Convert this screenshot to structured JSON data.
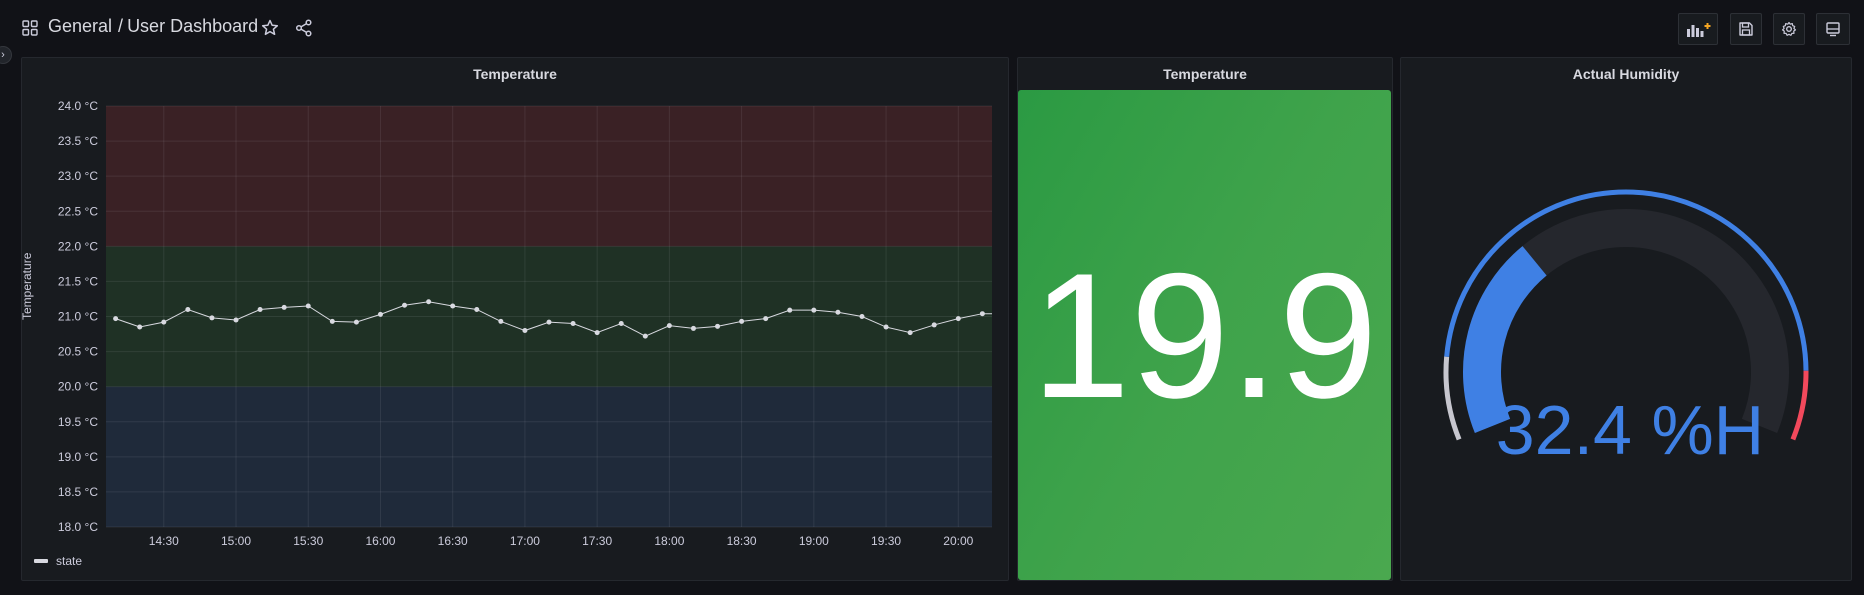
{
  "header": {
    "folder": "General",
    "separator": "/",
    "dashboard": "User Dashboard"
  },
  "panels": {
    "temp_graph": {
      "title": "Temperature"
    },
    "temp_stat": {
      "title": "Temperature",
      "value": "19.9",
      "color": "#3fa34b"
    },
    "humidity_gauge": {
      "title": "Actual Humidity",
      "value": "32.4 %H",
      "fraction": 0.324,
      "color": "#3f80e4"
    }
  },
  "chart_data": {
    "type": "line",
    "title": "Temperature",
    "ylabel": "Temperature",
    "ylim": [
      18.0,
      24.0
    ],
    "y_ticks": [
      "24.0 °C",
      "23.5 °C",
      "23.0 °C",
      "22.5 °C",
      "22.0 °C",
      "21.5 °C",
      "21.0 °C",
      "20.5 °C",
      "20.0 °C",
      "19.5 °C",
      "19.0 °C",
      "18.5 °C",
      "18.0 °C"
    ],
    "x_ticks": [
      "14:30",
      "15:00",
      "15:30",
      "16:00",
      "16:30",
      "17:00",
      "17:30",
      "18:00",
      "18:30",
      "19:00",
      "19:30",
      "20:00"
    ],
    "thresholds": [
      {
        "from": 18.0,
        "to": 20.0,
        "color": "#1f2a3a"
      },
      {
        "from": 20.0,
        "to": 22.0,
        "color": "#1f3125"
      },
      {
        "from": 22.0,
        "to": 24.0,
        "color": "#3a2125"
      }
    ],
    "legend_position": "bottom-left",
    "series": [
      {
        "name": "state",
        "color": "#d8d9e0",
        "x_minutes": [
          "14:10",
          "14:20",
          "14:30",
          "14:40",
          "14:50",
          "15:00",
          "15:10",
          "15:20",
          "15:30",
          "15:40",
          "15:50",
          "16:00",
          "16:10",
          "16:20",
          "16:30",
          "16:40",
          "16:50",
          "17:00",
          "17:10",
          "17:20",
          "17:30",
          "17:40",
          "17:50",
          "18:00",
          "18:10",
          "18:20",
          "18:30",
          "18:40",
          "18:50",
          "19:00",
          "19:10",
          "19:20",
          "19:30",
          "19:40",
          "19:50",
          "20:00",
          "20:10"
        ],
        "values": [
          20.97,
          20.85,
          20.92,
          21.1,
          20.98,
          20.95,
          21.1,
          21.13,
          21.15,
          20.93,
          20.92,
          21.03,
          21.16,
          21.21,
          21.15,
          21.1,
          20.93,
          20.8,
          20.92,
          20.9,
          20.77,
          20.9,
          20.72,
          20.87,
          20.83,
          20.86,
          20.93,
          20.97,
          21.09,
          21.09,
          21.06,
          21.0,
          20.85,
          20.77,
          20.88,
          20.97,
          21.04
        ]
      }
    ]
  }
}
